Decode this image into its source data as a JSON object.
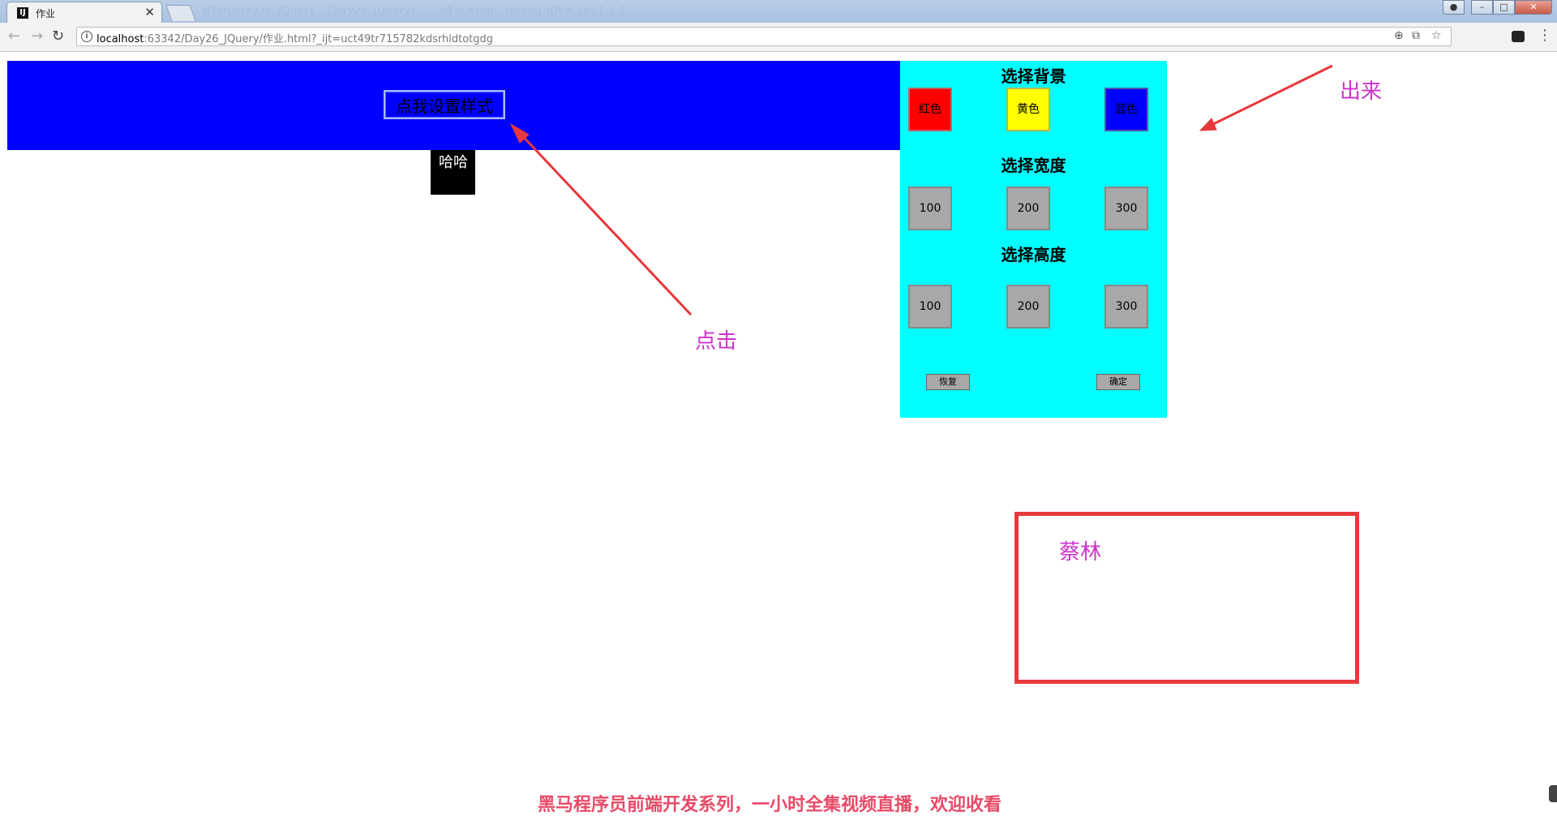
{
  "browser": {
    "tab_title": "作业",
    "tab_icon": "IJ",
    "tab_close": "✕",
    "background_window_title": "HTML/Day26_JQuery - [Day26_JQuery] - ...\\作业.html - IntelliJ IDEA 2017.2.2",
    "url_host": "localhost",
    "url_rest": ":63342/Day26_JQuery/作业.html?_ijt=uct49tr715782kdsrhldtotgdg"
  },
  "page": {
    "style_button_label": "点我设置样式",
    "box_text": "哈哈",
    "colors": {
      "bar_blue": "#0000ff",
      "panel_cyan": "#00ffff",
      "box_black": "#000000"
    }
  },
  "panel": {
    "bg_heading": "选择背景",
    "width_heading": "选择宽度",
    "height_heading": "选择高度",
    "bg_options": [
      {
        "label": "红色",
        "color": "#ff0000"
      },
      {
        "label": "黄色",
        "color": "#ffff00"
      },
      {
        "label": "蓝色",
        "color": "#0000ff"
      }
    ],
    "width_options": [
      "100",
      "200",
      "300"
    ],
    "height_options": [
      "100",
      "200",
      "300"
    ],
    "restore_label": "恢复",
    "ok_label": "确定"
  },
  "annotations": {
    "out_label": "出来",
    "click_label": "点击",
    "name_label": "蔡林",
    "color": "#e8383c",
    "text_color": "#cc33cc"
  },
  "watermark": "黑马程序员前端开发系列，一小时全集视频直播，欢迎收看"
}
